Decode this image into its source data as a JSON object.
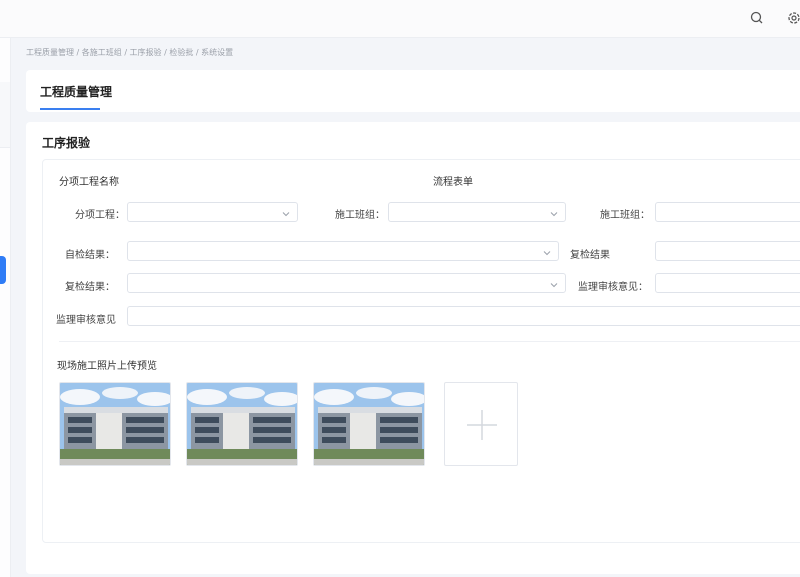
{
  "header": {
    "icons": [
      "search-icon",
      "settings-icon"
    ]
  },
  "breadcrumb": {
    "text": "工程质量管理 / 各施工班组 / 工序报验 / 检验批 / 系统设置"
  },
  "page": {
    "title": "工程质量管理"
  },
  "section": {
    "title": "工序报验",
    "subheading_left": "分项工程名称",
    "subheading_center": "流程表单"
  },
  "form": {
    "subproject_label": "分项工程：",
    "team_label_1": "施工班组：",
    "team_label_2": "施工班组：",
    "self_check_label": "自检结果：",
    "recheck_result_label": "复检结果",
    "recheck_label": "复检结果：",
    "supervisor_opinion_label_1": "监理审核意见：",
    "supervisor_opinion_label_2": "监理审核意见"
  },
  "photos": {
    "heading": "现场施工照片上传预览",
    "items": [
      {
        "alt": "building-photo-1"
      },
      {
        "alt": "building-photo-2"
      },
      {
        "alt": "building-photo-3"
      }
    ]
  },
  "colors": {
    "accent": "#2f7cf6",
    "background": "#f3f5f9",
    "card": "#ffffff"
  }
}
